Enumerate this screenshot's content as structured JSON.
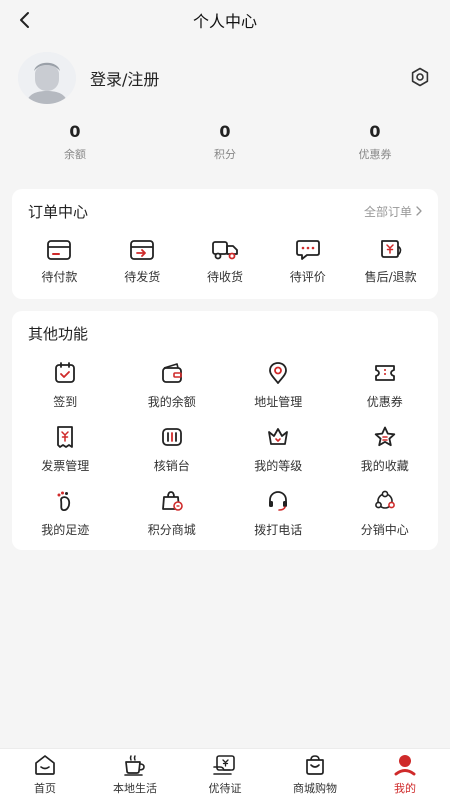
{
  "header": {
    "title": "个人中心"
  },
  "profile": {
    "login_label": "登录/注册"
  },
  "stats": [
    {
      "value": "0",
      "label": "余额"
    },
    {
      "value": "0",
      "label": "积分"
    },
    {
      "value": "0",
      "label": "优惠券"
    }
  ],
  "orders": {
    "title": "订单中心",
    "all_link": "全部订单",
    "items": [
      {
        "label": "待付款",
        "icon": "wallet-card-icon"
      },
      {
        "label": "待发货",
        "icon": "box-send-icon"
      },
      {
        "label": "待收货",
        "icon": "truck-icon"
      },
      {
        "label": "待评价",
        "icon": "comment-icon"
      },
      {
        "label": "售后/退款",
        "icon": "refund-icon"
      }
    ]
  },
  "others": {
    "title": "其他功能",
    "items": [
      {
        "label": "签到",
        "icon": "calendar-check-icon"
      },
      {
        "label": "我的余额",
        "icon": "wallet-icon"
      },
      {
        "label": "地址管理",
        "icon": "location-icon"
      },
      {
        "label": "优惠券",
        "icon": "coupon-icon"
      },
      {
        "label": "发票管理",
        "icon": "invoice-icon"
      },
      {
        "label": "核销台",
        "icon": "verify-icon"
      },
      {
        "label": "我的等级",
        "icon": "crown-icon"
      },
      {
        "label": "我的收藏",
        "icon": "star-icon"
      },
      {
        "label": "我的足迹",
        "icon": "footprint-icon"
      },
      {
        "label": "积分商城",
        "icon": "shopping-bag-icon"
      },
      {
        "label": "拨打电话",
        "icon": "headset-icon"
      },
      {
        "label": "分销中心",
        "icon": "share-icon"
      }
    ]
  },
  "tabbar": {
    "items": [
      {
        "label": "首页",
        "icon": "home-icon"
      },
      {
        "label": "本地生活",
        "icon": "coffee-icon"
      },
      {
        "label": "优待证",
        "icon": "card-icon"
      },
      {
        "label": "商城购物",
        "icon": "bag-icon"
      },
      {
        "label": "我的",
        "icon": "profile-icon"
      }
    ],
    "active_index": 4
  },
  "colors": {
    "accent": "#cf2a2a",
    "background": "#f5f5f5",
    "card": "#ffffff",
    "muted_text": "#888888"
  }
}
